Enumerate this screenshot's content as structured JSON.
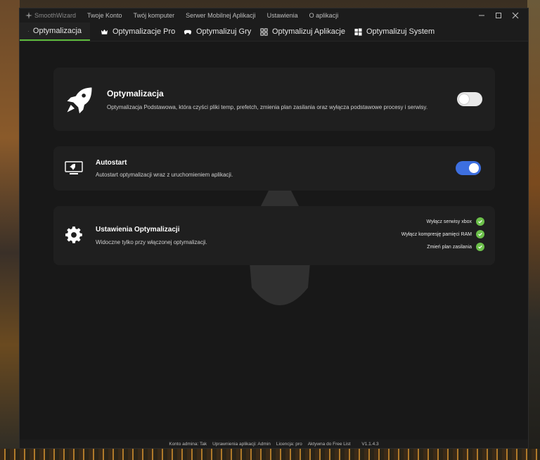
{
  "menu": {
    "app_name": "SmoothWizard",
    "items": [
      "Twoje Konto",
      "Twój komputer",
      "Serwer Mobilnej Aplikacji",
      "Ustawienia",
      "O aplikacji"
    ]
  },
  "tabs": [
    {
      "label": "Optymalizacja",
      "icon": "rocket-icon",
      "active": true
    },
    {
      "label": "Optymalizacje Pro",
      "icon": "crown-icon",
      "active": false
    },
    {
      "label": "Optymalizuj Gry",
      "icon": "gamepad-icon",
      "active": false
    },
    {
      "label": "Optymalizuj Aplikacje",
      "icon": "apps-grid-icon",
      "active": false
    },
    {
      "label": "Optymalizuj System",
      "icon": "windows-icon",
      "active": false
    }
  ],
  "cards": {
    "optimization": {
      "title": "Optymalizacja",
      "description": "Optymalizacja Podstawowa, która czyści pliki temp, prefetch, zmienia plan zasilania oraz wyłącza podstawowe procesy i serwisy.",
      "icon": "rocket-icon",
      "enabled": false
    },
    "autostart": {
      "title": "Autostart",
      "description": "Autostart optymalizacji wraz z uruchomieniem aplikacji.",
      "icon": "monitor-rocket-icon",
      "enabled": true
    },
    "settings": {
      "title": "Ustawienia Optymalizacji",
      "description": "Widoczne tylko przy włączonej optymalizacji.",
      "icon": "gear-icon",
      "options": [
        {
          "label": "Wyłącz serwisy xbox",
          "checked": true
        },
        {
          "label": "Wyłącz kompresję pamięci RAM",
          "checked": true
        },
        {
          "label": "Zmień plan zasilania",
          "checked": true
        }
      ]
    }
  },
  "status": {
    "admin": "Konto admina: Tak",
    "permissions": "Uprawnienia aplikacji: Admin",
    "license": "Licencja: pro",
    "free_list": "Aktywna do Free List",
    "version": "V1.1.4.3"
  },
  "colors": {
    "accent_green": "#5dbb3c",
    "toggle_on": "#3d6fe0",
    "check_green": "#6cc04a"
  }
}
